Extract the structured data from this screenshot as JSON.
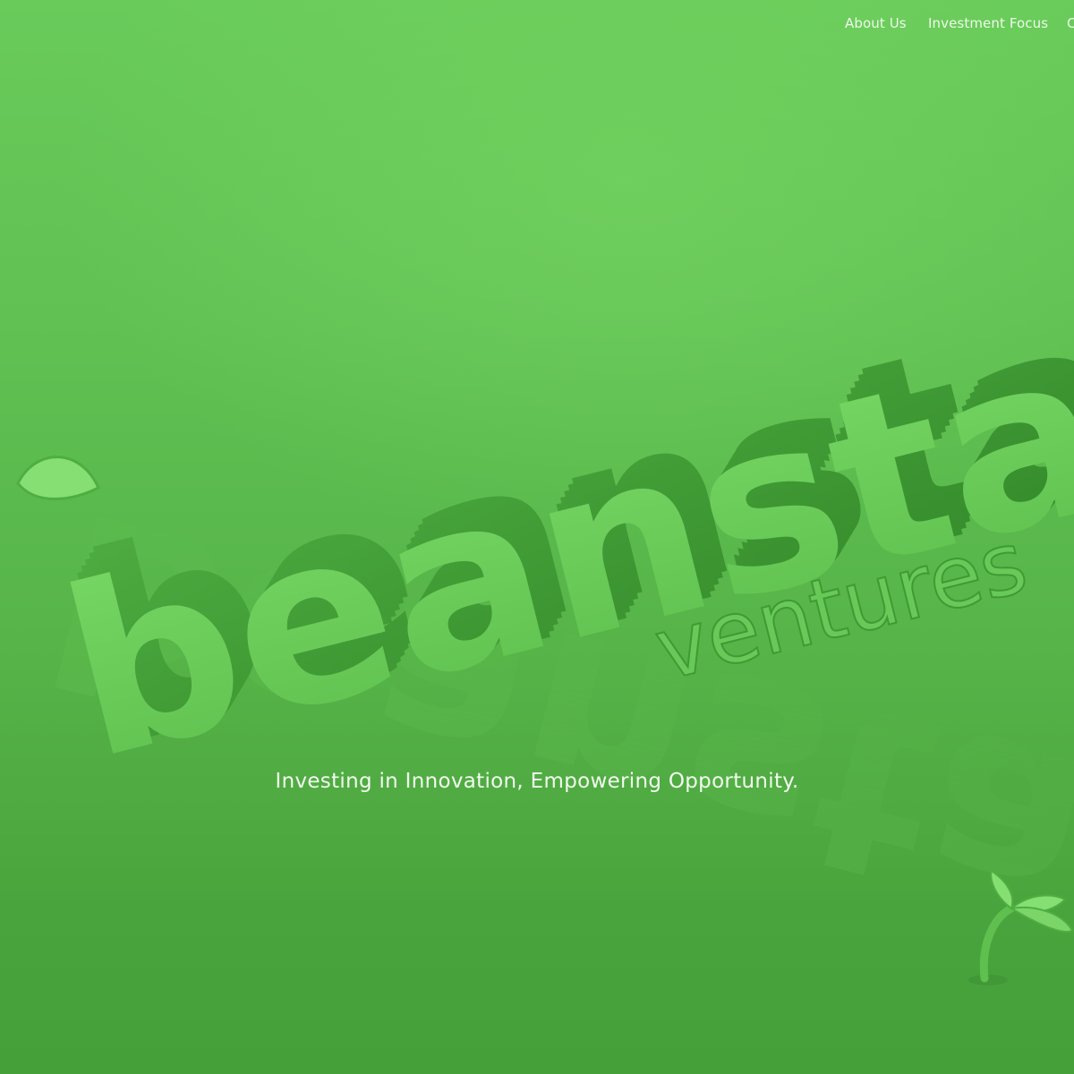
{
  "nav": {
    "items": [
      {
        "label": "About Us"
      },
      {
        "label": "Investment Focus"
      },
      {
        "label": "C"
      }
    ]
  },
  "hero": {
    "logo_text": "beanstalk",
    "logo_subtext": "ventures",
    "tagline": "Investing in Innovation, Empowering Opportunity."
  },
  "colors": {
    "background": "#5fbe50",
    "logo_face": "#6ecf5e",
    "logo_side": "#3f9a34",
    "text": "#f2faef"
  }
}
